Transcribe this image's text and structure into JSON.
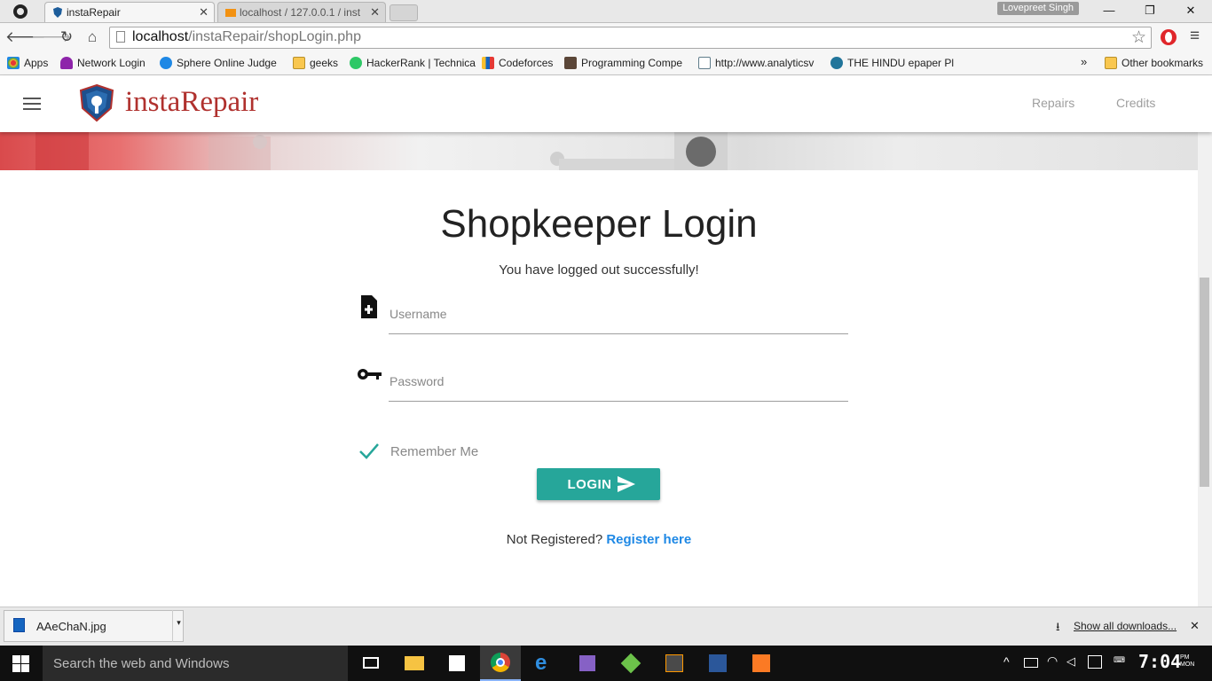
{
  "browser": {
    "tabs": [
      {
        "title": "instaRepair"
      },
      {
        "title": "localhost / 127.0.0.1 / inst"
      }
    ],
    "user": "Lovepreet Singh",
    "window_controls": {
      "minimize": "—",
      "restore": "❐",
      "close": "✕"
    },
    "url_host": "localhost",
    "url_path": "/instaRepair/shopLogin.php",
    "bookmarks": [
      {
        "label": "Apps",
        "icon": "apps-grid-icon",
        "color": "#e53935"
      },
      {
        "label": "Network Login",
        "icon": "umbrella-icon",
        "color": "#8e24aa"
      },
      {
        "label": "Sphere Online Judge",
        "icon": "spoj-icon",
        "color": "#1e88e5"
      },
      {
        "label": "geeks",
        "icon": "folder-icon",
        "color": "#f9c74f"
      },
      {
        "label": "HackerRank | Technica",
        "icon": "hackerrank-icon",
        "color": "#2ec866"
      },
      {
        "label": "Codeforces",
        "icon": "codeforces-icon",
        "color": "#1565c0"
      },
      {
        "label": "Programming Compe",
        "icon": "codechef-icon",
        "color": "#5b4638"
      },
      {
        "label": "http://www.analyticsv",
        "icon": "chart-icon",
        "color": "#607d8b"
      },
      {
        "label": "THE HINDU epaper Pl",
        "icon": "wordpress-icon",
        "color": "#21759b"
      }
    ],
    "bookmarks_overflow": "»",
    "other_bookmarks": "Other bookmarks"
  },
  "app": {
    "brand": "instaRepair",
    "nav": [
      {
        "label": "Repairs"
      },
      {
        "label": "Credits"
      }
    ],
    "login": {
      "title": "Shopkeeper Login",
      "message": "You have logged out successfully!",
      "username_placeholder": "Username",
      "password_placeholder": "Password",
      "remember_label": "Remember Me",
      "remember_checked": true,
      "button_label": "LOGIN",
      "not_registered": "Not Registered?",
      "register_link": "Register here"
    },
    "accent": "#26a69a",
    "brand_color": "#b0312e"
  },
  "downloads": {
    "file": "AAeChaN.jpg",
    "show_all": "Show all downloads..."
  },
  "taskbar": {
    "search_placeholder": "Search the web and Windows",
    "time": "7:04",
    "ampm": "PM",
    "day": "MON"
  }
}
